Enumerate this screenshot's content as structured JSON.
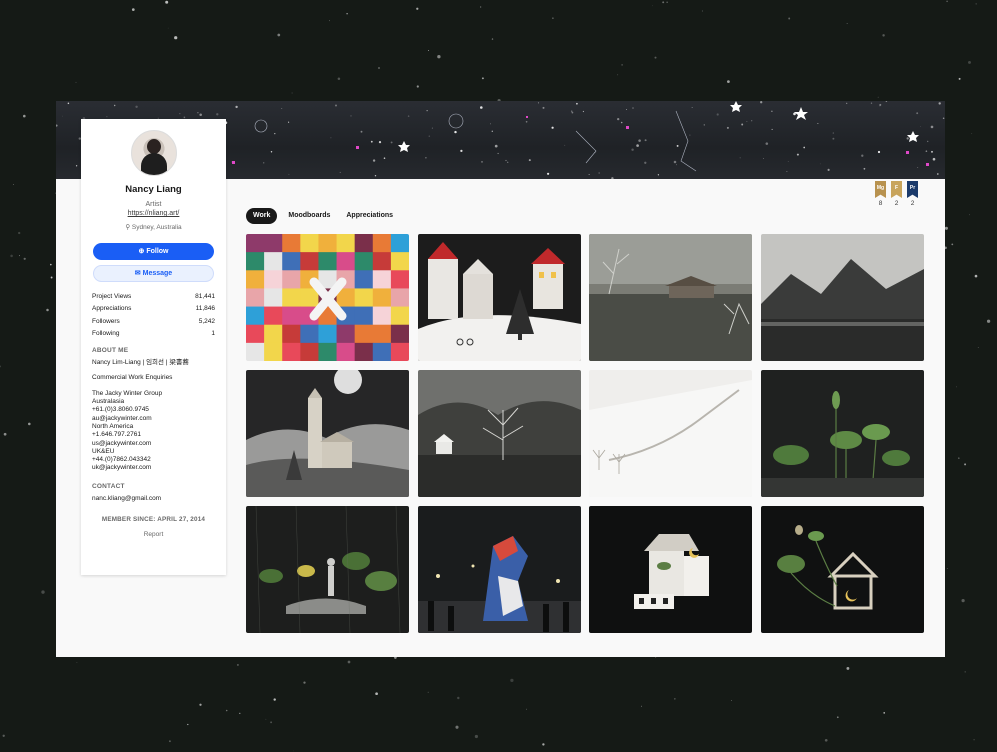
{
  "profile": {
    "name": "Nancy Liang",
    "role": "Artist",
    "website": "https://nliang.art/",
    "location": "Sydney, Australia",
    "follow_label": "Follow",
    "message_label": "Message",
    "stats": [
      {
        "label": "Project Views",
        "value": "81,441"
      },
      {
        "label": "Appreciations",
        "value": "11,846"
      },
      {
        "label": "Followers",
        "value": "5,242"
      },
      {
        "label": "Following",
        "value": "1"
      }
    ],
    "about_title": "ABOUT ME",
    "about_name": "Nancy Lim-Liang | 임희선 | 梁書蕎",
    "about_enquiries": "Commercial Work Enquiries",
    "agency": [
      "The Jacky Winter Group",
      "Australasia",
      "+61.(0)3.8060.9745",
      "au@jackywinter.com",
      "North America",
      "+1.646.797.2761",
      "us@jackywinter.com",
      "UK&EU",
      "+44.(0)7862.043342",
      "uk@jackywinter.com"
    ],
    "contact_title": "CONTACT",
    "contact_email": "nanc.kliang@gmail.com",
    "member_since": "MEMBER SINCE: APRIL 27, 2014",
    "report_label": "Report"
  },
  "tabs": [
    {
      "label": "Work",
      "active": true
    },
    {
      "label": "Moodboards",
      "active": false
    },
    {
      "label": "Appreciations",
      "active": false
    }
  ],
  "badges": [
    {
      "abbr": "Mg",
      "count": "8",
      "color": "#b8924f"
    },
    {
      "abbr": "F",
      "count": "2",
      "color": "#c8a45c"
    },
    {
      "abbr": "Pr",
      "count": "2",
      "color": "#1b3a6b"
    }
  ],
  "colors": {
    "accent": "#1a5ef5",
    "active_tab": "#191919"
  },
  "projects": [
    {
      "icon": "colorful-squares-artwork"
    },
    {
      "icon": "paper-village-artwork"
    },
    {
      "icon": "misty-lake-pavilion-artwork"
    },
    {
      "icon": "dark-mountains-artwork"
    },
    {
      "icon": "moon-tower-artwork"
    },
    {
      "icon": "foggy-forest-house-artwork"
    },
    {
      "icon": "snowy-hill-path-artwork"
    },
    {
      "icon": "lotus-leaves-artwork"
    },
    {
      "icon": "rain-lotus-figures-artwork"
    },
    {
      "icon": "paper-wolf-festival-artwork"
    },
    {
      "icon": "moon-house-artwork"
    },
    {
      "icon": "lotus-house-artwork"
    }
  ]
}
